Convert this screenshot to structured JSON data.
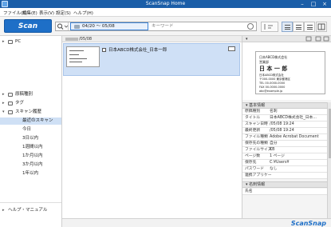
{
  "window": {
    "title": "ScanSnap Home"
  },
  "menu": [
    "ファイル(F)",
    "編集(E)",
    "表示(V)",
    "設定(S)",
    "ヘルプ(H)"
  ],
  "toolbar": {
    "scan_label": "Scan",
    "date_range": "04/20 ～ 05/08",
    "keyword_placeholder": "キーワード"
  },
  "sidebar": {
    "top_item": "PC",
    "items": [
      {
        "label": "原稿種別"
      },
      {
        "label": "タグ"
      },
      {
        "label": "スキャン履歴"
      },
      {
        "label": "最近のスキャン"
      },
      {
        "label": "今日"
      },
      {
        "label": "3日以内"
      },
      {
        "label": "1週間以内"
      },
      {
        "label": "1か月以内"
      },
      {
        "label": "3か月以内"
      },
      {
        "label": "1年以内"
      }
    ],
    "bottom": "ヘルプ・マニュアル"
  },
  "list": {
    "group_date": "/05/08",
    "doc_title": "日本ABCD株式会社_日本一郎"
  },
  "preview": {
    "card": {
      "company": "日本ABCD株式会社",
      "dept": "営業部",
      "name": "日 本 一 郎",
      "lines": [
        "日本ABCD株式会社",
        "〒000-0000 東京都港区",
        "TEL 00-0000-0000",
        "FAX 00-0000-0000",
        "abc@example.jp"
      ]
    }
  },
  "properties": {
    "section_title": "基本情報",
    "rows": [
      {
        "k": "原稿種別",
        "v": "名刺"
      },
      {
        "k": "タイトル",
        "v": "日本ABCD株式会社_日本..."
      },
      {
        "k": "スキャン日時",
        "v": "/05/08 19:24"
      },
      {
        "k": "最終更新",
        "v": "/05/08 19:24"
      },
      {
        "k": "ファイル種類",
        "v": "Adobe Acrobat Document"
      },
      {
        "k": "保存先の種類",
        "v": "自分"
      },
      {
        "k": "ファイルサイズ",
        "v": "KB"
      },
      {
        "k": "ページ数",
        "v": "1 ページ"
      },
      {
        "k": "保存先",
        "v": "C:¥Users¥"
      },
      {
        "k": "パスワード",
        "v": "なし"
      },
      {
        "k": "連携アプリケー",
        "v": ""
      }
    ],
    "section2_title": "名刺情報",
    "section2_first": "氏名"
  },
  "status": {
    "brand": "ScanSnap"
  }
}
